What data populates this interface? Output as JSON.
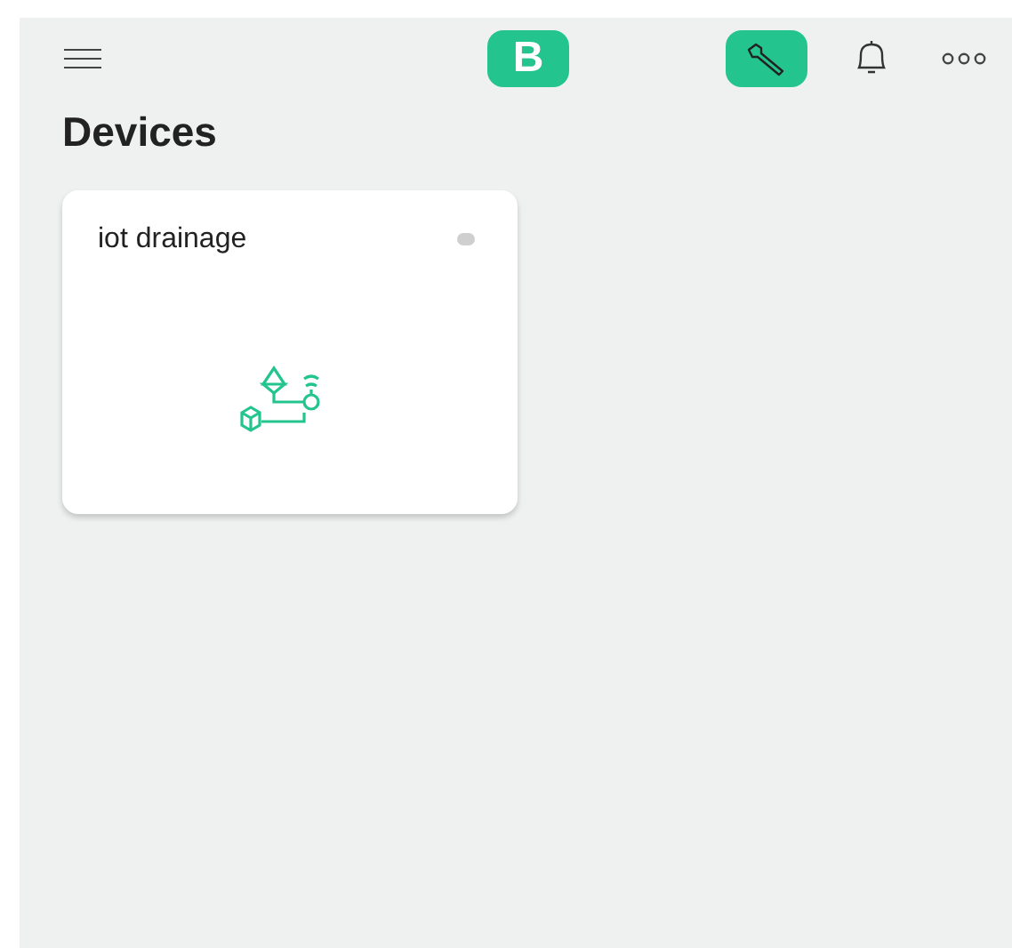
{
  "header": {
    "logo": "B"
  },
  "page_title": "Devices",
  "devices": [
    {
      "name": "iot drainage",
      "color": "#cfcfcf"
    }
  ]
}
